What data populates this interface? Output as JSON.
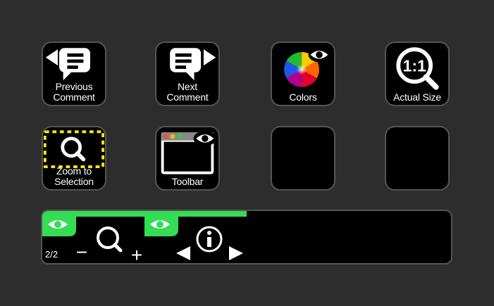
{
  "keys": [
    {
      "label_line1": "Previous",
      "label_line2": "Comment",
      "icon": "previous-comment-icon"
    },
    {
      "label_line1": "Next",
      "label_line2": "Comment",
      "icon": "next-comment-icon"
    },
    {
      "label_line1": "Colors",
      "label_line2": "",
      "icon": "color-wheel-eye-icon"
    },
    {
      "label_line1": "Actual Size",
      "label_line2": "",
      "icon": "actual-size-magnifier-icon"
    },
    {
      "label_line1": "Zoom to",
      "label_line2": "Selection",
      "icon": "zoom-to-selection-icon"
    },
    {
      "label_line1": "Toolbar",
      "label_line2": "",
      "icon": "toolbar-window-eye-icon"
    },
    {
      "label_line1": "",
      "label_line2": "",
      "icon": ""
    },
    {
      "label_line1": "",
      "label_line2": "",
      "icon": ""
    }
  ],
  "dial": {
    "page_indicator": "2/2",
    "progress_fraction": 0.5,
    "zoom": {
      "minus": "−",
      "plus": "+",
      "icon": "magnifier-icon",
      "badge_icon": "eye-icon"
    },
    "info": {
      "icon": "info-icon",
      "badge_icon": "eye-icon",
      "left_icon": "triangle-left-icon",
      "right_icon": "triangle-right-icon"
    }
  },
  "colors": {
    "background": "#2d2d2d",
    "key_border": "#555555",
    "accent_green": "#33dd55",
    "selection_dash": "#ffee00"
  }
}
